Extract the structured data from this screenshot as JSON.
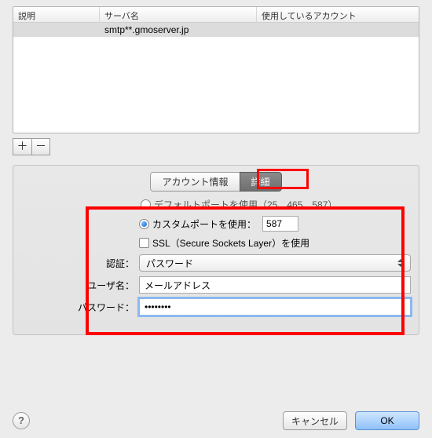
{
  "table": {
    "headers": {
      "c1": "説明",
      "c2": "サーバ名",
      "c3": "使用しているアカウント"
    },
    "row": {
      "c1": "",
      "c2": "smtp**.gmoserver.jp",
      "c3": ""
    }
  },
  "buttons": {
    "add": "＋",
    "remove": "－"
  },
  "tabs": {
    "info": "アカウント情報",
    "advanced": "詳細"
  },
  "form": {
    "default_port_label": "デフォルトポートを使用（25、465、587）",
    "custom_port_label": "カスタムポートを使用：",
    "custom_port_value": "587",
    "ssl_label": "SSL（Secure Sockets Layer）を使用",
    "auth_label": "認証：",
    "auth_value": "パスワード",
    "user_label": "ユーザ名：",
    "user_value": "メールアドレス",
    "pass_label": "パスワード：",
    "pass_value": "••••••••"
  },
  "footer": {
    "help": "?",
    "cancel": "キャンセル",
    "ok": "OK"
  }
}
